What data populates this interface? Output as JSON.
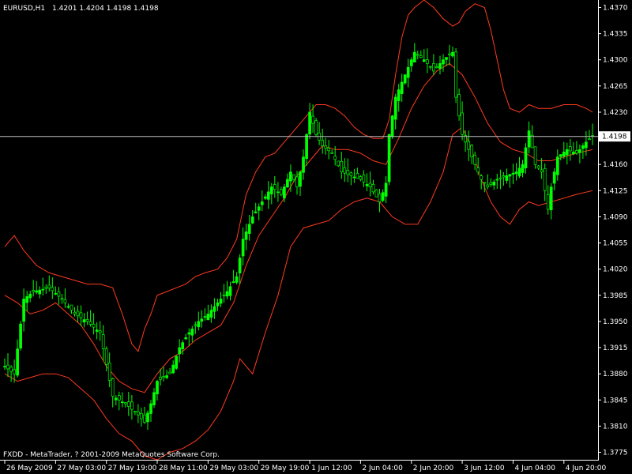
{
  "chart_data": {
    "type": "candlestick",
    "header": {
      "symbol": "EURUSD,H1",
      "ohlc": "1.4201 1.4204 1.4198 1.4198"
    },
    "current_price_label": "1.4198",
    "current_price": 1.4198,
    "footer": "FXDD - MetaTrader, ? 2001-2009 MetaQuotes Software Corp.",
    "ylim": [
      1.3765,
      1.438
    ],
    "y_ticks": [
      {
        "v": 1.437,
        "label": "1.4370"
      },
      {
        "v": 1.4335,
        "label": "1.4335"
      },
      {
        "v": 1.43,
        "label": "1.4300"
      },
      {
        "v": 1.4265,
        "label": "1.4265"
      },
      {
        "v": 1.423,
        "label": "1.4230"
      },
      {
        "v": 1.416,
        "label": "1.4160"
      },
      {
        "v": 1.4125,
        "label": "1.4125"
      },
      {
        "v": 1.409,
        "label": "1.4090"
      },
      {
        "v": 1.4055,
        "label": "1.4055"
      },
      {
        "v": 1.402,
        "label": "1.4020"
      },
      {
        "v": 1.3985,
        "label": "1.3985"
      },
      {
        "v": 1.395,
        "label": "1.3950"
      },
      {
        "v": 1.3915,
        "label": "1.3915"
      },
      {
        "v": 1.388,
        "label": "1.3880"
      },
      {
        "v": 1.3845,
        "label": "1.3845"
      },
      {
        "v": 1.381,
        "label": "1.3810"
      },
      {
        "v": 1.3775,
        "label": "1.3775"
      }
    ],
    "x_ticks": [
      {
        "i": 0,
        "label": "26 May 2009"
      },
      {
        "i": 16,
        "label": "27 May 03:00"
      },
      {
        "i": 32,
        "label": "27 May 19:00"
      },
      {
        "i": 48,
        "label": "28 May 11:00"
      },
      {
        "i": 64,
        "label": "29 May 03:00"
      },
      {
        "i": 80,
        "label": "29 May 19:00"
      },
      {
        "i": 96,
        "label": "1 Jun 12:00"
      },
      {
        "i": 112,
        "label": "2 Jun 04:00"
      },
      {
        "i": 128,
        "label": "2 Jun 20:00"
      },
      {
        "i": 144,
        "label": "3 Jun 12:00"
      },
      {
        "i": 160,
        "label": "4 Jun 04:00"
      },
      {
        "i": 176,
        "label": "4 Jun 20:00"
      }
    ],
    "bar_count": 186,
    "price_path": [
      [
        0,
        1.389
      ],
      [
        3,
        1.388
      ],
      [
        6,
        1.398
      ],
      [
        9,
        1.399
      ],
      [
        14,
        1.3995
      ],
      [
        18,
        1.398
      ],
      [
        22,
        1.396
      ],
      [
        26,
        1.395
      ],
      [
        30,
        1.3935
      ],
      [
        34,
        1.385
      ],
      [
        38,
        1.384
      ],
      [
        42,
        1.3825
      ],
      [
        44,
        1.3815
      ],
      [
        46,
        1.384
      ],
      [
        48,
        1.387
      ],
      [
        52,
        1.388
      ],
      [
        55,
        1.3915
      ],
      [
        58,
        1.3935
      ],
      [
        61,
        1.395
      ],
      [
        64,
        1.396
      ],
      [
        67,
        1.3975
      ],
      [
        70,
        1.399
      ],
      [
        73,
        1.401
      ],
      [
        75,
        1.406
      ],
      [
        78,
        1.409
      ],
      [
        81,
        1.411
      ],
      [
        84,
        1.413
      ],
      [
        87,
        1.412
      ],
      [
        90,
        1.415
      ],
      [
        92,
        1.413
      ],
      [
        94,
        1.417
      ],
      [
        96,
        1.423
      ],
      [
        98,
        1.42
      ],
      [
        100,
        1.4185
      ],
      [
        103,
        1.4175
      ],
      [
        106,
        1.415
      ],
      [
        109,
        1.4145
      ],
      [
        112,
        1.414
      ],
      [
        115,
        1.413
      ],
      [
        118,
        1.411
      ],
      [
        120,
        1.4135
      ],
      [
        121,
        1.42
      ],
      [
        123,
        1.425
      ],
      [
        126,
        1.428
      ],
      [
        129,
        1.431
      ],
      [
        132,
        1.43
      ],
      [
        135,
        1.4285
      ],
      [
        138,
        1.43
      ],
      [
        141,
        1.431
      ],
      [
        142,
        1.425
      ],
      [
        144,
        1.42
      ],
      [
        147,
        1.417
      ],
      [
        150,
        1.414
      ],
      [
        152,
        1.413
      ],
      [
        155,
        1.414
      ],
      [
        158,
        1.4145
      ],
      [
        161,
        1.415
      ],
      [
        163,
        1.416
      ],
      [
        165,
        1.4205
      ],
      [
        167,
        1.416
      ],
      [
        169,
        1.415
      ],
      [
        171,
        1.41
      ],
      [
        172,
        1.413
      ],
      [
        174,
        1.417
      ],
      [
        177,
        1.418
      ],
      [
        180,
        1.4175
      ],
      [
        183,
        1.419
      ],
      [
        185,
        1.4198
      ]
    ],
    "upper_band": [
      [
        0,
        1.405
      ],
      [
        3,
        1.4065
      ],
      [
        6,
        1.4045
      ],
      [
        10,
        1.4025
      ],
      [
        14,
        1.4015
      ],
      [
        18,
        1.401
      ],
      [
        22,
        1.4005
      ],
      [
        26,
        1.4
      ],
      [
        30,
        1.4
      ],
      [
        34,
        1.3995
      ],
      [
        37,
        1.396
      ],
      [
        40,
        1.392
      ],
      [
        42,
        1.391
      ],
      [
        44,
        1.394
      ],
      [
        46,
        1.396
      ],
      [
        48,
        1.3985
      ],
      [
        51,
        1.399
      ],
      [
        54,
        1.3995
      ],
      [
        57,
        1.4
      ],
      [
        60,
        1.401
      ],
      [
        63,
        1.4015
      ],
      [
        67,
        1.402
      ],
      [
        70,
        1.4035
      ],
      [
        73,
        1.406
      ],
      [
        76,
        1.412
      ],
      [
        79,
        1.415
      ],
      [
        82,
        1.417
      ],
      [
        85,
        1.4175
      ],
      [
        88,
        1.419
      ],
      [
        92,
        1.421
      ],
      [
        95,
        1.4225
      ],
      [
        98,
        1.424
      ],
      [
        101,
        1.424
      ],
      [
        104,
        1.4235
      ],
      [
        107,
        1.4225
      ],
      [
        110,
        1.421
      ],
      [
        113,
        1.42
      ],
      [
        116,
        1.4195
      ],
      [
        119,
        1.4195
      ],
      [
        121,
        1.422
      ],
      [
        123,
        1.428
      ],
      [
        125,
        1.433
      ],
      [
        127,
        1.436
      ],
      [
        129,
        1.437
      ],
      [
        132,
        1.438
      ],
      [
        135,
        1.437
      ],
      [
        138,
        1.4355
      ],
      [
        141,
        1.4345
      ],
      [
        143,
        1.435
      ],
      [
        145,
        1.4365
      ],
      [
        148,
        1.4375
      ],
      [
        151,
        1.437
      ],
      [
        153,
        1.434
      ],
      [
        155,
        1.43
      ],
      [
        157,
        1.426
      ],
      [
        159,
        1.4235
      ],
      [
        162,
        1.423
      ],
      [
        165,
        1.424
      ],
      [
        168,
        1.4235
      ],
      [
        172,
        1.4235
      ],
      [
        176,
        1.424
      ],
      [
        180,
        1.424
      ],
      [
        183,
        1.4235
      ],
      [
        185,
        1.423
      ]
    ],
    "middle_band": [
      [
        0,
        1.3985
      ],
      [
        4,
        1.3975
      ],
      [
        8,
        1.396
      ],
      [
        12,
        1.3965
      ],
      [
        16,
        1.3975
      ],
      [
        20,
        1.396
      ],
      [
        24,
        1.3945
      ],
      [
        28,
        1.392
      ],
      [
        32,
        1.389
      ],
      [
        36,
        1.387
      ],
      [
        40,
        1.386
      ],
      [
        44,
        1.3855
      ],
      [
        48,
        1.388
      ],
      [
        52,
        1.39
      ],
      [
        56,
        1.391
      ],
      [
        60,
        1.3925
      ],
      [
        64,
        1.3935
      ],
      [
        68,
        1.3945
      ],
      [
        72,
        1.3975
      ],
      [
        76,
        1.4025
      ],
      [
        80,
        1.4065
      ],
      [
        84,
        1.409
      ],
      [
        88,
        1.4115
      ],
      [
        92,
        1.4145
      ],
      [
        96,
        1.4165
      ],
      [
        100,
        1.4185
      ],
      [
        104,
        1.418
      ],
      [
        108,
        1.418
      ],
      [
        112,
        1.4175
      ],
      [
        116,
        1.4165
      ],
      [
        120,
        1.416
      ],
      [
        124,
        1.4195
      ],
      [
        128,
        1.4235
      ],
      [
        132,
        1.4265
      ],
      [
        136,
        1.4285
      ],
      [
        140,
        1.4295
      ],
      [
        144,
        1.428
      ],
      [
        148,
        1.425
      ],
      [
        152,
        1.4215
      ],
      [
        156,
        1.419
      ],
      [
        160,
        1.418
      ],
      [
        164,
        1.4175
      ],
      [
        168,
        1.4165
      ],
      [
        172,
        1.4165
      ],
      [
        176,
        1.417
      ],
      [
        180,
        1.4175
      ],
      [
        185,
        1.418
      ]
    ],
    "lower_band": [
      [
        0,
        1.388
      ],
      [
        4,
        1.387
      ],
      [
        8,
        1.3875
      ],
      [
        12,
        1.388
      ],
      [
        16,
        1.388
      ],
      [
        20,
        1.3875
      ],
      [
        24,
        1.386
      ],
      [
        28,
        1.3845
      ],
      [
        32,
        1.382
      ],
      [
        36,
        1.38
      ],
      [
        40,
        1.379
      ],
      [
        44,
        1.377
      ],
      [
        48,
        1.3765
      ],
      [
        52,
        1.3775
      ],
      [
        56,
        1.378
      ],
      [
        60,
        1.379
      ],
      [
        64,
        1.3805
      ],
      [
        68,
        1.383
      ],
      [
        72,
        1.387
      ],
      [
        74,
        1.39
      ],
      [
        76,
        1.389
      ],
      [
        78,
        1.388
      ],
      [
        82,
        1.3935
      ],
      [
        86,
        1.3985
      ],
      [
        90,
        1.405
      ],
      [
        94,
        1.4075
      ],
      [
        98,
        1.408
      ],
      [
        102,
        1.4085
      ],
      [
        106,
        1.41
      ],
      [
        110,
        1.411
      ],
      [
        114,
        1.4115
      ],
      [
        118,
        1.411
      ],
      [
        122,
        1.409
      ],
      [
        126,
        1.408
      ],
      [
        130,
        1.408
      ],
      [
        134,
        1.411
      ],
      [
        138,
        1.415
      ],
      [
        141,
        1.42
      ],
      [
        144,
        1.421
      ],
      [
        147,
        1.418
      ],
      [
        150,
        1.414
      ],
      [
        153,
        1.411
      ],
      [
        156,
        1.409
      ],
      [
        159,
        1.408
      ],
      [
        162,
        1.41
      ],
      [
        165,
        1.411
      ],
      [
        168,
        1.4105
      ],
      [
        172,
        1.411
      ],
      [
        176,
        1.4115
      ],
      [
        180,
        1.412
      ],
      [
        185,
        1.4125
      ]
    ],
    "colors": {
      "background": "#000000",
      "candle": "#00ff00",
      "bands": "#ff3b1f",
      "axis": "#ffffff",
      "price_line": "#c0c0c0"
    }
  }
}
